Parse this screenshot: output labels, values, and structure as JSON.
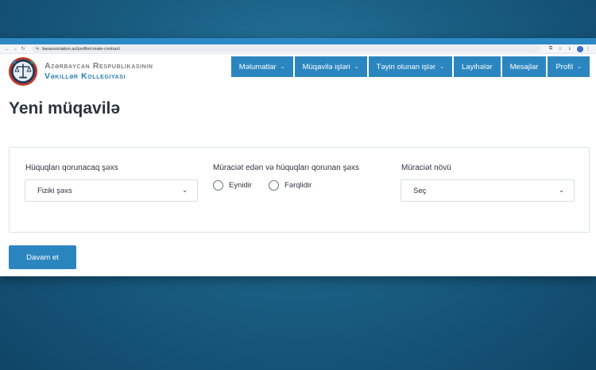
{
  "browser": {
    "url": "barassociation.az/profile/create-contract",
    "nav_icons": [
      "back-arrow-icon",
      "forward-arrow-icon",
      "reload-icon",
      "site-info-icon"
    ],
    "right_icons": [
      "translate-icon",
      "star-icon",
      "download-icon",
      "profile-avatar-icon",
      "more-icon"
    ]
  },
  "brand": {
    "line1": "Azərbaycan Respublikasının",
    "line2": "Vəkillər Kollegiyası"
  },
  "menu": [
    {
      "label": "Məlumatlar",
      "dropdown": true
    },
    {
      "label": "Müqavilə işləri",
      "dropdown": true
    },
    {
      "label": "Təyin olunan işlər",
      "dropdown": true
    },
    {
      "label": "Layihələr",
      "dropdown": false
    },
    {
      "label": "Mesajlar",
      "dropdown": false
    },
    {
      "label": "Profil",
      "dropdown": true
    }
  ],
  "page": {
    "title": "Yeni müqavilə"
  },
  "form": {
    "protected_person": {
      "label": "Hüquqları qorunacaq şəxs",
      "value": "Fiziki şəxs"
    },
    "applicant": {
      "label": "Müraciət edən və hüquqları qorunan şəxs",
      "options": [
        "Eynidir",
        "Fərqlidir"
      ]
    },
    "request_type": {
      "label": "Müraciət növü",
      "value": "Seç"
    },
    "submit_label": "Davam et"
  },
  "colors": {
    "accent": "#2b86c0",
    "background": "#1a5f84",
    "text": "#2c3440"
  }
}
